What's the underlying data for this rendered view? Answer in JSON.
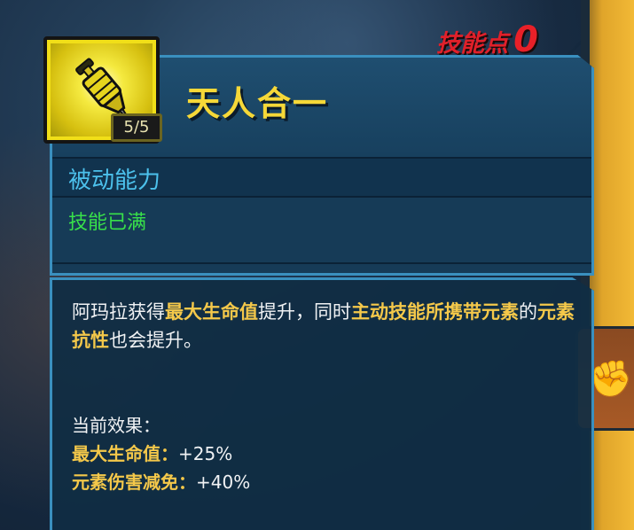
{
  "skill_points": {
    "label": "技能点",
    "value": "0"
  },
  "skill": {
    "title": "天人合一",
    "rank": "5/5",
    "type": "被动能力",
    "status": "技能已满"
  },
  "description": {
    "segments": [
      {
        "text": "阿玛拉获得",
        "highlight": false
      },
      {
        "text": "最大生命值",
        "highlight": true
      },
      {
        "text": "提升，同时",
        "highlight": false
      },
      {
        "text": "主动技能所携带元素",
        "highlight": true
      },
      {
        "text": "的",
        "highlight": false
      },
      {
        "text": "元素抗性",
        "highlight": true
      },
      {
        "text": "也会提升。",
        "highlight": false
      }
    ]
  },
  "effects": {
    "header": "当前效果：",
    "items": [
      {
        "name": "最大生命值：",
        "value": "+25%"
      },
      {
        "name": "元素伤害减免：",
        "value": "+40%"
      }
    ]
  },
  "colors": {
    "title": "#f6d838",
    "type": "#4cc1ec",
    "status": "#38e04a",
    "highlight": "#f4c84a",
    "skill_points": "#e82028",
    "panel_border": "#3a90bf"
  },
  "icons": {
    "skill_icon": "syringe-icon",
    "side_icon": "fist-icon"
  }
}
